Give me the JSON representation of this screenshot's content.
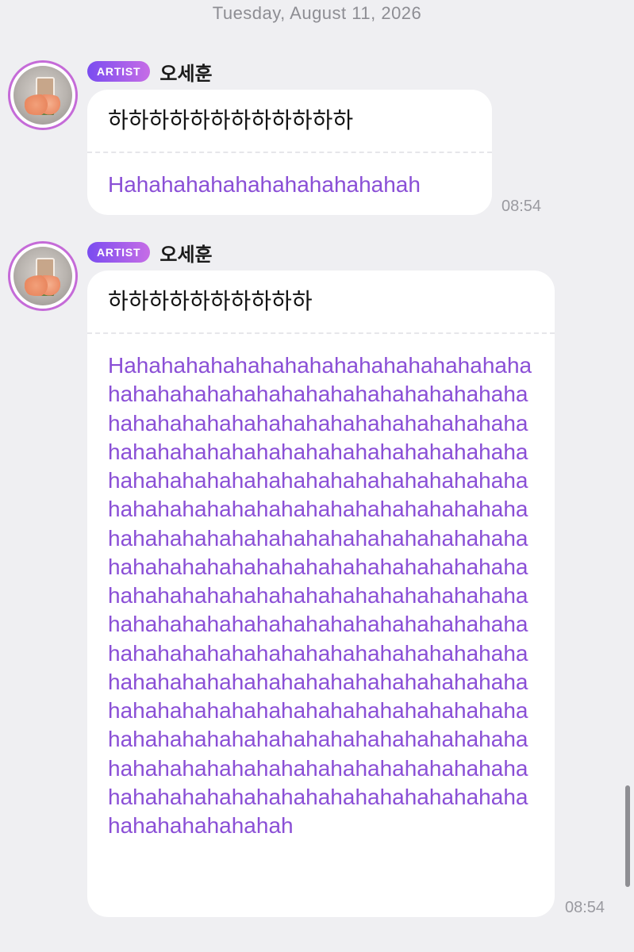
{
  "date_header": "Tuesday, August 11, 2026",
  "messages": [
    {
      "badge": "ARTIST",
      "sender": "오세훈",
      "original": "하하하하하하하하하하하하",
      "translation": "Hahahahahahahahahahahahah",
      "time": "08:54"
    },
    {
      "badge": "ARTIST",
      "sender": "오세훈",
      "original": "하하하하하하하하하하",
      "translation": "Hahahahahahahahahahahahahahahahahahahahahahahahahahahahahahahahahahahahahahahahahahahahahahahahahahahahahahahahahahahahahahahahahahahahahahahahahahahahahahahahahahahahahahahahahahahahahahahahahahahahahahahahahahahahahahahahahahahahahahahahahahahahahahahahahahahahahahahahahahahahahahahahahahahahahahahahahahahahahahahahahahahahahahahahahahahahahahahahahahahahahahahahahahahahahahahahahahahahahahahahahahahahahahahahahahahahahahahahahahahahahahahahahahahahahahahahahahahahahahahahahahahahahahahahahahahahahahahahahahahahahahahahahahahahahahahahahahahahahahahah",
      "time": "08:54"
    }
  ],
  "colors": {
    "background": "#efeff2",
    "badge_start": "#7a4cf0",
    "badge_end": "#c66de6",
    "translation_text": "#8a4fd6"
  },
  "icons": {
    "avatar": "artist-avatar"
  }
}
